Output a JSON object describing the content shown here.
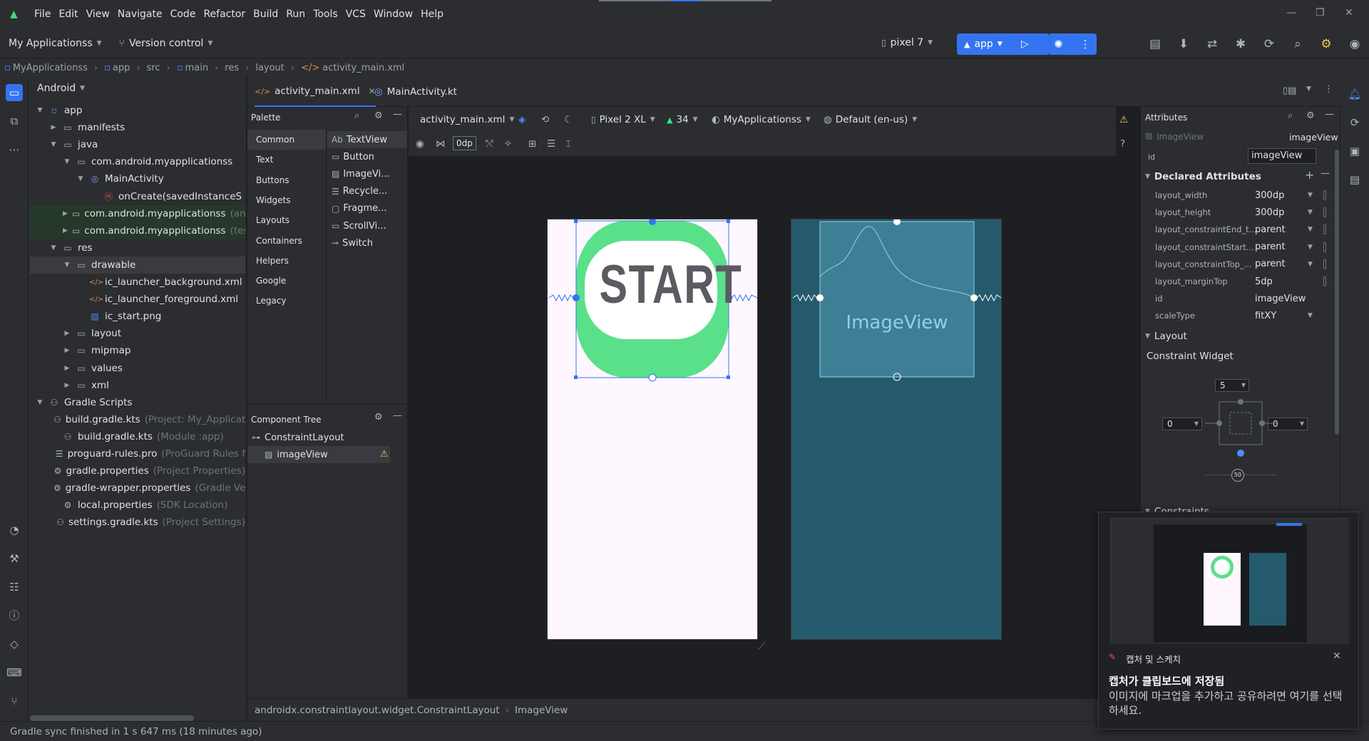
{
  "menu": [
    "File",
    "Edit",
    "View",
    "Navigate",
    "Code",
    "Refactor",
    "Build",
    "Run",
    "Tools",
    "VCS",
    "Window",
    "Help"
  ],
  "toolbar": {
    "project": "My Applicationss",
    "vcs": "Version control",
    "device": "pixel 7",
    "run_config": "app"
  },
  "breadcrumb": [
    "MyApplicationss",
    "app",
    "src",
    "main",
    "res",
    "layout",
    "activity_main.xml"
  ],
  "project_panel": {
    "title": "Android",
    "tree": [
      {
        "label": "app",
        "level": 0,
        "expanded": true,
        "icon": "module-icon"
      },
      {
        "label": "manifests",
        "level": 1,
        "expanded": false,
        "icon": "folder-icon"
      },
      {
        "label": "java",
        "level": 1,
        "expanded": true,
        "icon": "folder-icon"
      },
      {
        "label": "com.android.myapplicationss",
        "level": 2,
        "expanded": true,
        "icon": "package-icon"
      },
      {
        "label": "MainActivity",
        "level": 3,
        "expanded": true,
        "icon": "kotlin-class-icon"
      },
      {
        "label": "onCreate(savedInstanceS",
        "level": 4,
        "icon": "method-icon"
      },
      {
        "label": "com.android.myapplicationss",
        "hint": "(andr",
        "level": 2,
        "expanded": false,
        "icon": "package-icon"
      },
      {
        "label": "com.android.myapplicationss",
        "hint": "(test",
        "level": 2,
        "expanded": false,
        "icon": "package-icon"
      },
      {
        "label": "res",
        "level": 1,
        "expanded": true,
        "icon": "folder-icon"
      },
      {
        "label": "drawable",
        "level": 2,
        "expanded": true,
        "icon": "folder-icon"
      },
      {
        "label": "ic_launcher_background.xml",
        "level": 3,
        "icon": "xml-icon"
      },
      {
        "label": "ic_launcher_foreground.xml",
        "level": 3,
        "icon": "xml-icon"
      },
      {
        "label": "ic_start.png",
        "level": 3,
        "icon": "image-icon"
      },
      {
        "label": "layout",
        "level": 2,
        "expanded": false,
        "icon": "folder-icon"
      },
      {
        "label": "mipmap",
        "level": 2,
        "expanded": false,
        "icon": "folder-icon"
      },
      {
        "label": "values",
        "level": 2,
        "expanded": false,
        "icon": "folder-icon"
      },
      {
        "label": "xml",
        "level": 2,
        "expanded": false,
        "icon": "folder-icon"
      },
      {
        "label": "Gradle Scripts",
        "level": 0,
        "expanded": true,
        "icon": "gradle-icon"
      },
      {
        "label": "build.gradle.kts",
        "hint": "(Project: My_Applicati",
        "level": 1,
        "icon": "gradle-file-icon"
      },
      {
        "label": "build.gradle.kts",
        "hint": "(Module :app)",
        "level": 1,
        "icon": "gradle-file-icon"
      },
      {
        "label": "proguard-rules.pro",
        "hint": "(ProGuard Rules f",
        "level": 1,
        "icon": "text-file-icon"
      },
      {
        "label": "gradle.properties",
        "hint": "(Project Properties)",
        "level": 1,
        "icon": "settings-file-icon"
      },
      {
        "label": "gradle-wrapper.properties",
        "hint": "(Gradle Ve",
        "level": 1,
        "icon": "settings-file-icon"
      },
      {
        "label": "local.properties",
        "hint": "(SDK Location)",
        "level": 1,
        "icon": "settings-file-icon"
      },
      {
        "label": "settings.gradle.kts",
        "hint": "(Project Settings)",
        "level": 1,
        "icon": "gradle-file-icon"
      }
    ]
  },
  "editor_tabs": [
    {
      "label": "activity_main.xml",
      "active": true
    },
    {
      "label": "MainActivity.kt",
      "active": false
    }
  ],
  "palette": {
    "title": "Palette",
    "categories": [
      "Common",
      "Text",
      "Buttons",
      "Widgets",
      "Layouts",
      "Containers",
      "Helpers",
      "Google",
      "Legacy"
    ],
    "items": [
      {
        "prefix": "Ab",
        "label": "TextView"
      },
      {
        "prefix": "▭",
        "label": "Button"
      },
      {
        "prefix": "▨",
        "label": "ImageVi..."
      },
      {
        "prefix": "☰",
        "label": "Recycle..."
      },
      {
        "prefix": "▢",
        "label": "Fragme..."
      },
      {
        "prefix": "▭",
        "label": "ScrollVi..."
      },
      {
        "prefix": "⊸",
        "label": "Switch"
      }
    ]
  },
  "component_tree": {
    "title": "Component Tree",
    "root": "ConstraintLayout",
    "child": "imageView"
  },
  "design_toolbar": {
    "file": "activity_main.xml",
    "device": "Pixel 2 XL",
    "api": "34",
    "theme": "MyApplicationss",
    "locale": "Default (en-us)",
    "margin": "0dp"
  },
  "canvas": {
    "start_text": "START",
    "imageview_label": "ImageView"
  },
  "attributes": {
    "title": "Attributes",
    "component": "ImageView",
    "component_id": "imageView",
    "id_label": "id",
    "id_value": "imageView",
    "declared_title": "Declared Attributes",
    "declared": [
      {
        "name": "layout_width",
        "value": "300dp",
        "dropdown": true
      },
      {
        "name": "layout_height",
        "value": "300dp",
        "dropdown": true
      },
      {
        "name": "layout_constraintEnd_t...",
        "value": "parent",
        "dropdown": true
      },
      {
        "name": "layout_constraintStart...",
        "value": "parent",
        "dropdown": true
      },
      {
        "name": "layout_constraintTop_...",
        "value": "parent",
        "dropdown": true
      },
      {
        "name": "layout_marginTop",
        "value": "5dp",
        "dropdown": false
      },
      {
        "name": "id",
        "value": "imageView",
        "dropdown": false
      },
      {
        "name": "scaleType",
        "value": "fitXY",
        "dropdown": true
      }
    ],
    "layout_title": "Layout",
    "constraint_widget": "Constraint Widget",
    "margin_top": "5",
    "margin_left": "0",
    "margin_right": "0",
    "bias": "50",
    "constraints_title": "Constraints"
  },
  "crumbbar": [
    "androidx.constraintlayout.widget.ConstraintLayout",
    "ImageView"
  ],
  "status": "Gradle sync finished in 1 s 647 ms (18 minutes ago)",
  "toast": {
    "app": "캡처 및 스케치",
    "title": "캡처가 클립보드에 저장됨",
    "body": "이미지에 마크업을 추가하고 공유하려면 여기를 선택하세요."
  },
  "colors": {
    "accent": "#3574f0",
    "android_green": "#3ddc84",
    "blueprint": "#245a6c",
    "warning": "#f2c55c"
  }
}
